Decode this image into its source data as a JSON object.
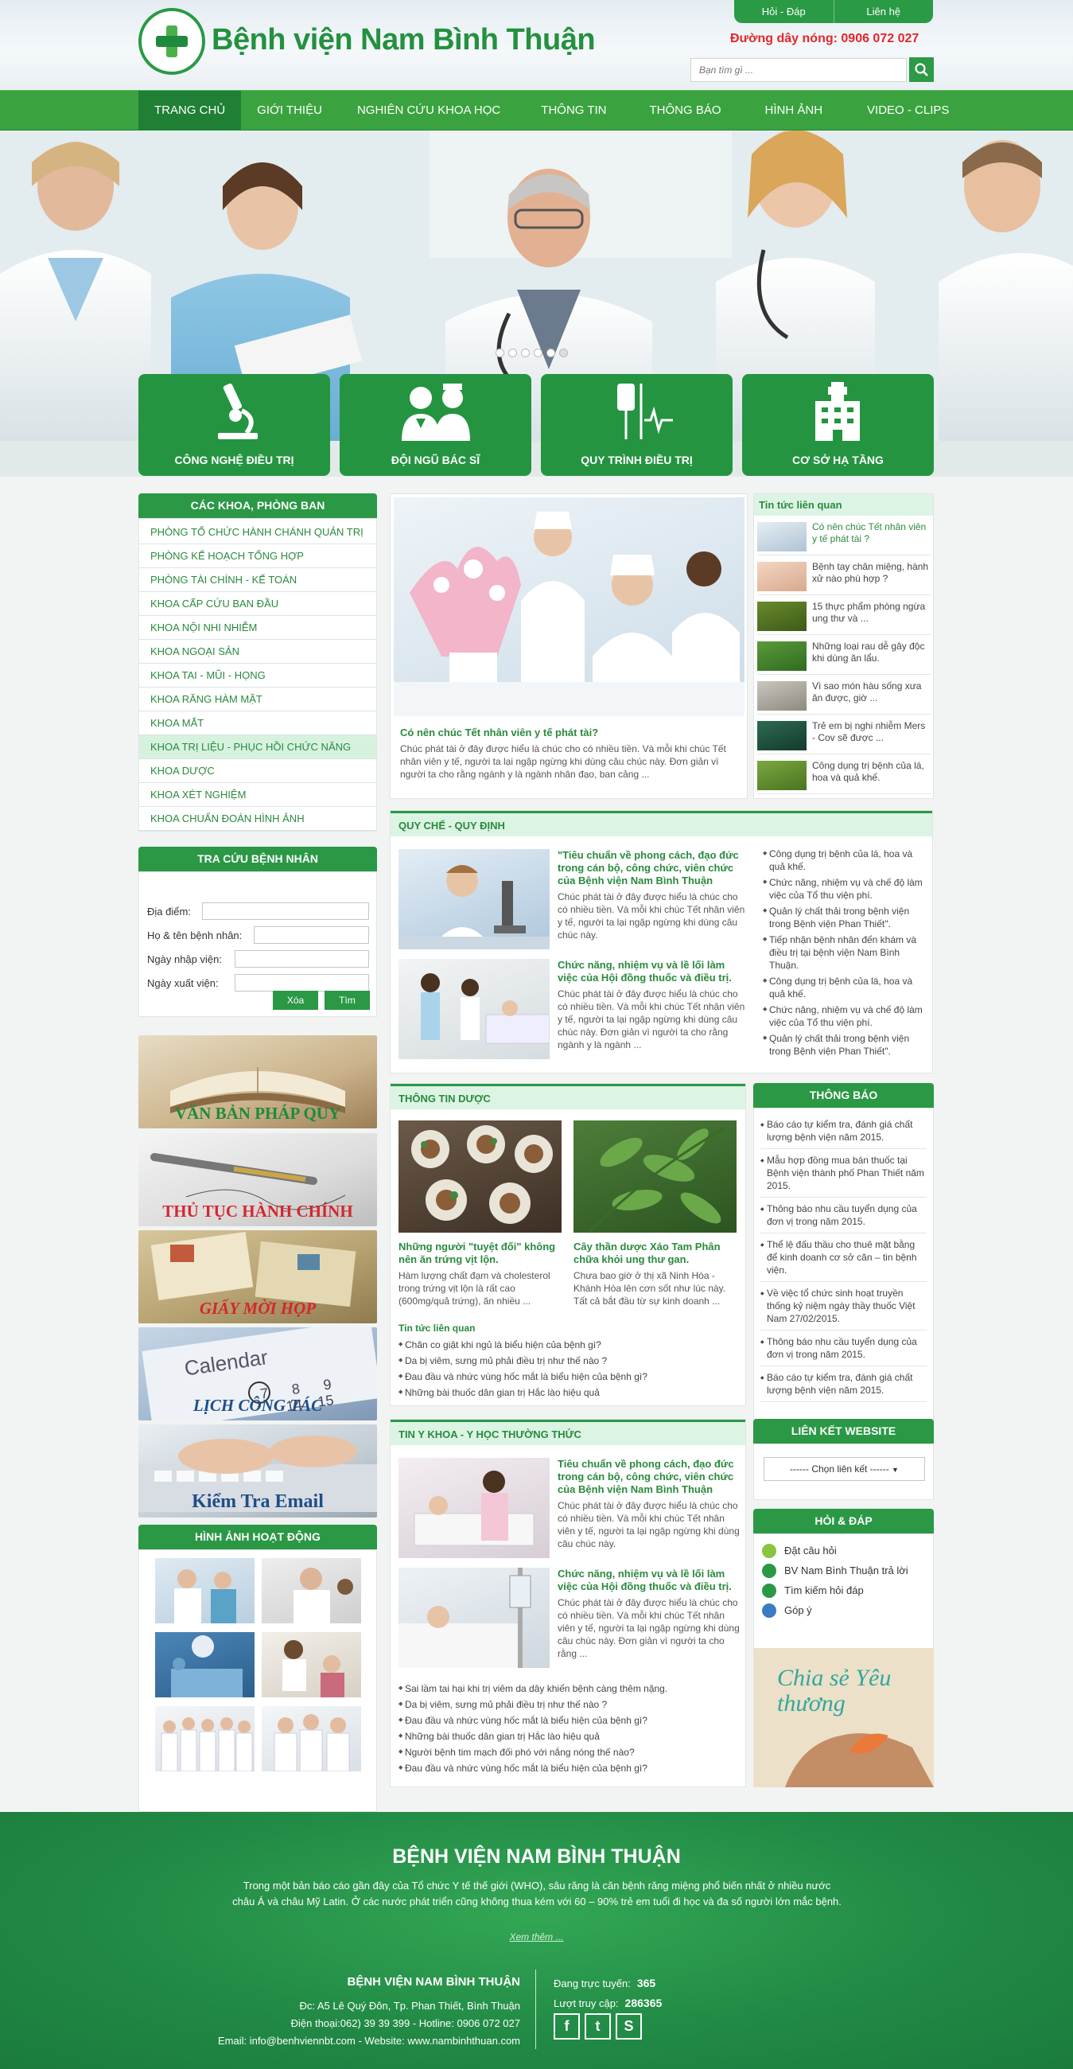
{
  "header": {
    "site_name": "Bệnh viện Nam Bình Thuận",
    "top_links": [
      "Hỏi - Đáp",
      "Liên hệ"
    ],
    "hotline": "Đường dây nóng: 0906 072 027",
    "search_placeholder": "Bạn tìm gì ..."
  },
  "nav": [
    "TRANG CHỦ",
    "GIỚI THIỆU",
    "NGHIÊN CỨU KHOA HỌC",
    "THÔNG TIN",
    "THÔNG BÁO",
    "HÌNH ẢNH",
    "VIDEO - CLIPS"
  ],
  "features": [
    "CÔNG NGHỆ ĐIỀU TRỊ",
    "ĐỘI NGŨ BÁC SĨ",
    "QUY TRÌNH ĐIỀU TRỊ",
    "CƠ SỞ HẠ TẦNG"
  ],
  "departments": {
    "title": "CÁC KHOA, PHÒNG BAN",
    "items": [
      "PHÒNG TỔ CHỨC HÀNH CHÁNH QUẢN TRỊ",
      "PHÒNG KẾ HOẠCH TỔNG HỢP",
      "PHÒNG TÀI CHÍNH - KẾ TOÁN",
      "KHOA CẤP CỨU BAN ĐẦU",
      "KHOA NỘI NHI NHIỄM",
      "KHOA NGOẠI SẢN",
      "KHOA TAI - MŨI - HỌNG",
      "KHOA RĂNG HÀM MẶT",
      "KHOA MẮT",
      "KHOA TRỊ LIỆU - PHỤC HỒI CHỨC NĂNG",
      "KHOA DƯỢC",
      "KHOA XÉT NGHIỆM",
      "KHOA CHUẨN ĐOÁN HÌNH ẢNH"
    ]
  },
  "lookup": {
    "title": "TRA CỨU BỆNH NHÂN",
    "fields": [
      "Địa điểm:",
      "Họ & tên bệnh nhân:",
      "Ngày nhập viện:",
      "Ngày xuất viện:"
    ],
    "clear_label": "Xóa",
    "search_label": "Tìm"
  },
  "promos": [
    "VĂN BẢN PHÁP QUY",
    "THỦ TỤC HÀNH CHÍNH",
    "GIẤY MỜI HỌP",
    "LỊCH CÔNG TÁC",
    "Kiểm Tra Email"
  ],
  "gallery_title": "HÌNH ẢNH HOẠT ĐỘNG",
  "feature_article": {
    "title": "Có nên chúc Tết nhân viên y tế phát tài?",
    "text": "Chúc phát tài ở đây được hiểu là chúc cho có nhiều tiền. Và mỗi khi chúc Tết nhân viên y tế, người ta lại ngập ngừng khi dùng câu chúc này. Đơn giản vì người ta cho rằng ngành y là ngành nhân đạo, ban cảng ..."
  },
  "related_news": {
    "title": "Tin tức liên quan",
    "items": [
      "Có nên chúc Tết nhân viên y tế phát tài ?",
      "Bệnh tay chân miệng, hành xử nào phù hợp ?",
      "15 thực phẩm phòng ngừa ung thư và ...",
      "Những loại rau dễ gây độc khi dùng ăn lẩu.",
      "Vì sao món hàu sống xưa ăn được, giờ ...",
      "Trẻ em bị nghi nhiễm Mers - Cov sẽ được ...",
      "Công dụng trị bệnh của lá, hoa và quả khế."
    ]
  },
  "regulations": {
    "title": "QUY CHẾ - QUY ĐỊNH",
    "articles": [
      {
        "title": "\"Tiêu chuẩn về phong cách, đạo đức trong cán bộ, công chức, viên chức của Bệnh viện Nam Bình Thuận",
        "text": "Chúc phát tài ở đây được hiểu là chúc cho có nhiều tiền. Và mỗi khi chúc Tết nhân viên y tế, người ta lại ngập ngừng khi dùng câu chúc này."
      },
      {
        "title": "Chức năng, nhiệm vụ và lề lối làm việc của Hội đồng thuốc và điều trị.",
        "text": "Chúc phát tài ở đây được hiểu là chúc cho có nhiều tiền. Và mỗi khi chúc Tết nhân viên y tế, người ta lại ngập ngừng khi dùng câu chúc này. Đơn giản vì người ta cho rằng ngành y là ngành ..."
      }
    ],
    "links": [
      "Công dụng trị bệnh của lá, hoa và quả khế.",
      "Chức năng, nhiệm vụ và chế độ làm việc của Tổ thu viện phí.",
      "Quản lý chất thải trong bệnh viện trong Bệnh viện Phan Thiết\".",
      "Tiếp nhận bệnh nhân đến khám và điều trị tại bệnh viện Nam Bình Thuận.",
      "Công dụng trị bệnh của lá, hoa và quả khế.",
      "Chức năng, nhiệm vụ và chế độ làm việc của Tổ thu viện phí.",
      "Quản lý chất thải trong bệnh viện trong Bệnh viện Phan Thiết\"."
    ]
  },
  "pharma": {
    "title": "THÔNG TIN DƯỢC",
    "articles": [
      {
        "title": "Những người \"tuyệt đối\" không nên ăn trứng vịt lộn.",
        "text": "Hàm lượng chất đạm và cholesterol trong trứng vịt lộn là rất cao (600mg/quả trứng), ăn nhiều ..."
      },
      {
        "title": "Cây thần dược Xáo Tam Phân chữa khỏi ung thư gan.",
        "text": "Chưa bao giờ ở thị xã Ninh Hòa - Khánh Hòa lên cơn sốt như lúc này. Tất cả bắt đầu từ sự kinh doanh ..."
      }
    ],
    "related_title": "Tin tức liên quan",
    "related": [
      "Chăn co giật khi ngủ là biểu hiện của bệnh gì?",
      "Da bị viêm, sưng mủ phải điều trị như thế nào ?",
      "Đau đầu và nhức vùng hốc mắt là biểu hiện của bệnh gì?",
      "Những bài thuốc dân gian trị Hắc lào hiệu quả"
    ]
  },
  "medicine": {
    "title": "TIN Y KHOA - Y HỌC THƯỜNG THỨC",
    "articles": [
      {
        "title": "Tiêu chuẩn về phong cách, đạo đức trong cán bộ, công chức, viên chức của Bệnh viện Nam Bình Thuận",
        "text": "Chúc phát tài ở đây được hiểu là chúc cho có nhiều tiền. Và mỗi khi chúc Tết nhân viên y tế, người ta lại ngập ngừng khi dùng câu chúc này."
      },
      {
        "title": "Chức năng, nhiệm vụ và lề lối làm việc của Hội đồng thuốc và điều trị.",
        "text": "Chúc phát tài ở đây được hiểu là chúc cho có nhiều tiền. Và mỗi khi chúc Tết nhân viên y tế, người ta lại ngập ngừng khi dùng câu chúc này. Đơn giản vì người ta cho rằng ..."
      }
    ],
    "links": [
      "Sai lầm tai hại khi trị viêm da dây khiến bệnh càng thêm nặng.",
      "Da bị viêm, sưng mủ phải điều trị như thế nào ?",
      "Đau đầu và nhức vùng hốc mắt là biểu hiện của bệnh gì?",
      "Những bài thuốc dân gian trị Hắc lào hiệu quả",
      "Người bệnh tim mạch đối phó với nắng nóng thế nào?",
      "Đau đầu và nhức vùng hốc mắt là biểu hiện của bệnh gì?"
    ]
  },
  "notices": {
    "title": "THÔNG BÁO",
    "items": [
      "Báo cáo tự kiểm tra, đánh giá chất lượng bệnh viện năm 2015.",
      "Mẫu hợp đồng mua bán thuốc tại Bệnh viện thành phố Phan Thiết năm 2015.",
      "Thông báo nhu cầu tuyển dụng của đơn vị trong năm 2015.",
      "Thể lệ đấu thầu cho thuê mặt bằng để kinh doanh cơ sở căn – tin bệnh viện.",
      "Về việc tổ chức sinh hoạt truyền thống kỷ niệm ngày thầy thuốc Việt Nam 27/02/2015.",
      "Thông báo nhu cầu tuyển dụng của đơn vị trong năm 2015.",
      "Báo cáo tự kiểm tra, đánh giá chất lượng bệnh viện năm 2015."
    ]
  },
  "web_links": {
    "title": "LIÊN KẾT WEBSITE",
    "select": "------ Chọn liên kết ------"
  },
  "qa": {
    "title": "HỎI & ĐÁP",
    "items": [
      "Đặt câu hỏi",
      "BV Nam Bình Thuận trả lời",
      "Tìm kiếm hỏi đáp",
      "Góp ý"
    ]
  },
  "share_text": "Chia sẻ Yêu thương",
  "footer": {
    "title": "BỆNH VIỆN NAM BÌNH THUẬN",
    "desc": "Trong một bản báo cáo gần đây của Tổ chức Y tế thế giới (WHO), sâu răng là căn bệnh răng miệng phổ biến nhất ở nhiều nước châu Á và châu Mỹ Latin. Ở các nước phát triển cũng không thua kém với 60 – 90% trẻ em tuổi đi học và đa số người lớn mắc bệnh.",
    "more": "Xem thêm ...",
    "name": "BỆNH VIỆN NAM BÌNH THUẬN",
    "address": "Đc: A5 Lê Quý Đôn, Tp. Phan Thiết, Bình Thuận",
    "phone": "Điện thoại:062) 39 39 399 - Hotline: 0906 072 027",
    "email": "Email: info@benhviennbt.com - Website: www.nambinhthuan.com",
    "online_label": "Đang trực tuyến:",
    "online_value": "365",
    "visits_label": "Lượt truy cập:",
    "visits_value": "286365",
    "social": [
      "f",
      "t",
      "S"
    ]
  }
}
